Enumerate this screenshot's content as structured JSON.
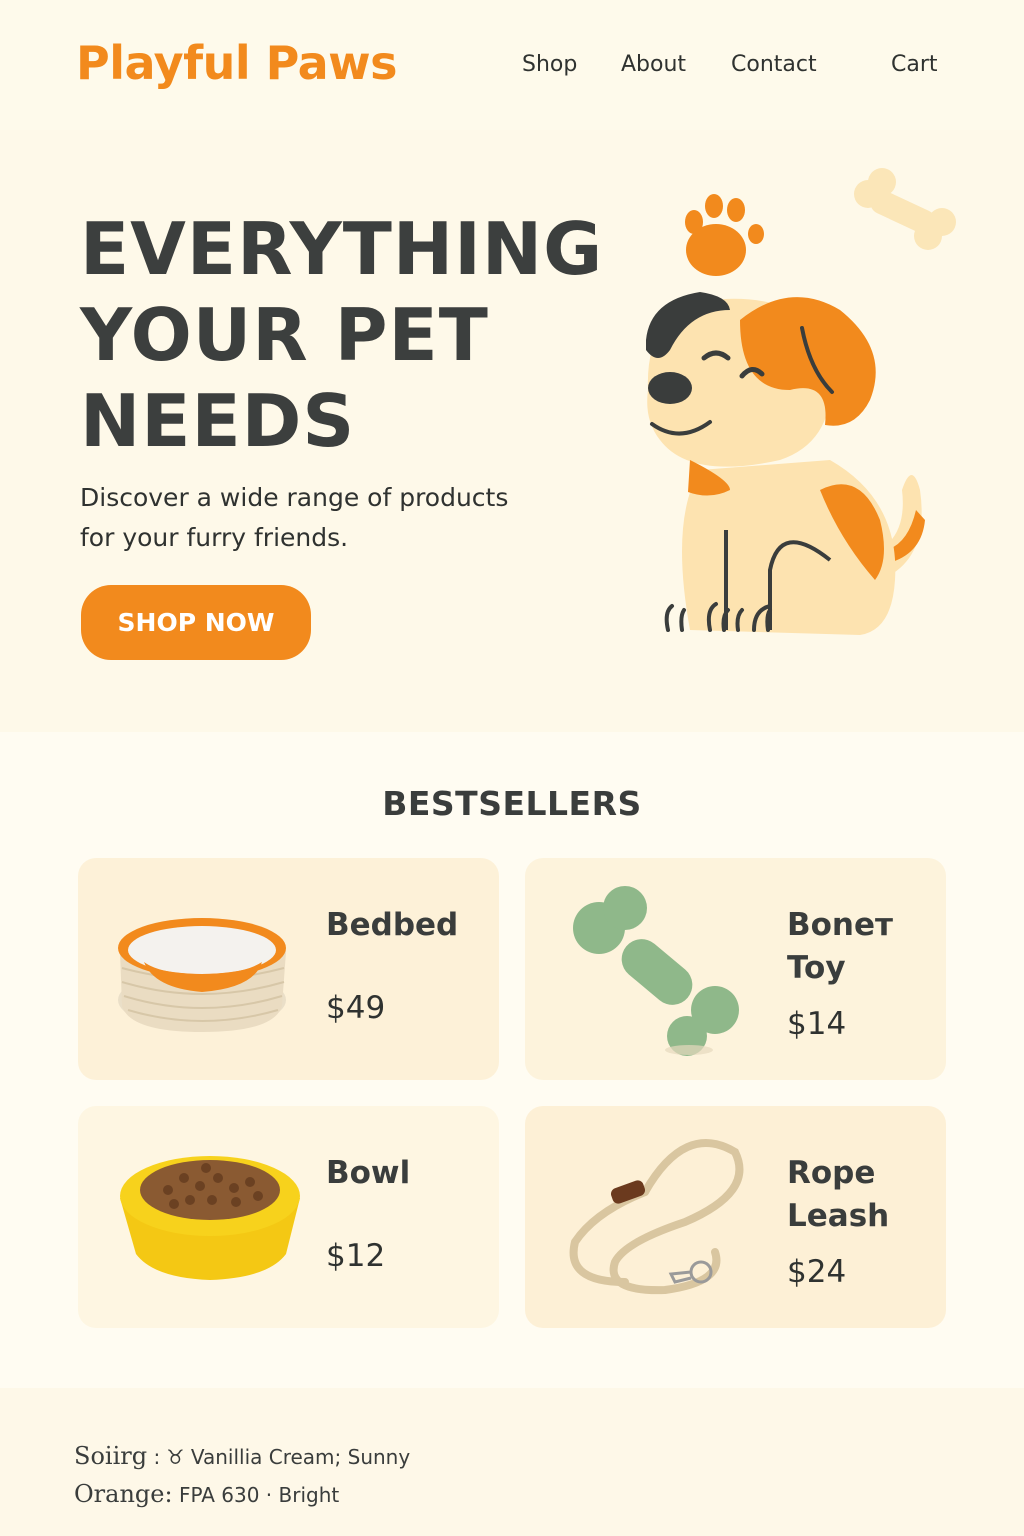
{
  "brand": {
    "logo_text": "Playful Paws"
  },
  "nav": {
    "shop": "Shop",
    "about": "About",
    "contact": "Contact",
    "cart": "Cart"
  },
  "hero": {
    "title_lines": [
      "EVERYTHING",
      "YOUR PET",
      "NEEDS"
    ],
    "subtitle": "Discover a wide range of products for your furry friends.",
    "cta_label": "SHOP NOW",
    "illustration_icons": [
      "paw-print-icon",
      "bone-icon",
      "puppy-illustration"
    ]
  },
  "bestsellers": {
    "heading": "BESTSELLERS",
    "products": [
      {
        "name_lines": [
          "Bedbed"
        ],
        "price": "$49",
        "image": "pet-bed-image"
      },
      {
        "name_lines": [
          "Boneᴛ",
          "Toy"
        ],
        "price": "$14",
        "image": "bone-toy-image"
      },
      {
        "name_lines": [
          "Bowl"
        ],
        "price": "$12",
        "image": "food-bowl-image"
      },
      {
        "name_lines": [
          "Rope",
          "Leash"
        ],
        "price": "$24",
        "image": "rope-leash-image"
      }
    ]
  },
  "footer": {
    "line1": {
      "lead": "Soiirg",
      "middle": ": ",
      "rest": "Vanillia Cream;   Sunny"
    },
    "line2": {
      "lead": "Orange:",
      "rest": "FPA 630 · Bright"
    }
  },
  "colors": {
    "accent": "#f28a1d",
    "text_dark": "#3a3d3c",
    "background": "#fefaeb",
    "card": "#fdf1d8"
  }
}
